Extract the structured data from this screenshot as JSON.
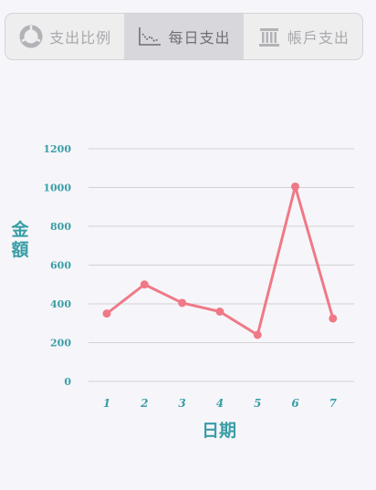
{
  "tabs": [
    {
      "label": "支出比例",
      "icon": "pie-chart-icon",
      "active": false
    },
    {
      "label": "每日支出",
      "icon": "line-chart-icon",
      "active": true
    },
    {
      "label": "帳戶支出",
      "icon": "bank-icon",
      "active": false
    }
  ],
  "colors": {
    "axis_text": "#3a9ea6",
    "line": "#f07987",
    "grid": "#d2d2d6"
  },
  "chart_data": {
    "type": "line",
    "xlabel": "日期",
    "ylabel": "金額",
    "x": [
      "1",
      "2",
      "3",
      "4",
      "5",
      "6",
      "7"
    ],
    "series": [
      {
        "values": [
          350,
          500,
          405,
          360,
          240,
          1005,
          325
        ]
      }
    ],
    "ylim": [
      0,
      1200
    ],
    "yticks": [
      0,
      200,
      400,
      600,
      800,
      1000,
      1200
    ],
    "grid": true
  }
}
